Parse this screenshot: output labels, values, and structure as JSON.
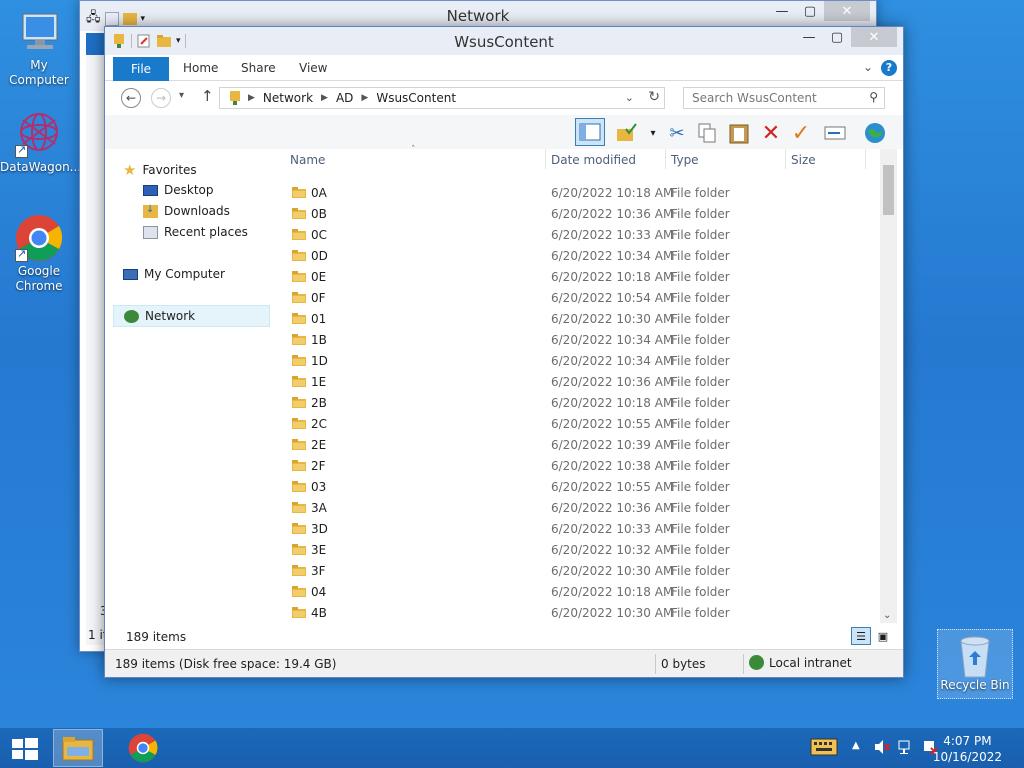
{
  "desktop": {
    "icons": [
      {
        "label": "My Computer"
      },
      {
        "label": "DataWagon..."
      },
      {
        "label": "Google Chrome"
      }
    ],
    "recycle_bin": "Recycle Bin"
  },
  "back_window": {
    "title": "Network",
    "items_stub": "1 it",
    "stub_three": "3"
  },
  "window": {
    "title": "WsusContent",
    "ribbon": {
      "file": "File",
      "tabs": [
        "Home",
        "Share",
        "View"
      ]
    },
    "address": {
      "segments": [
        "Network",
        "AD",
        "WsusContent"
      ],
      "search_placeholder": "Search WsusContent"
    },
    "nav": {
      "favorites": "Favorites",
      "desktop": "Desktop",
      "downloads": "Downloads",
      "recent": "Recent places",
      "my_computer": "My Computer",
      "network": "Network"
    },
    "columns": {
      "name": "Name",
      "date": "Date modified",
      "type": "Type",
      "size": "Size"
    },
    "rows": [
      {
        "name": "0A",
        "date": "6/20/2022 10:18 AM",
        "type": "File folder"
      },
      {
        "name": "0B",
        "date": "6/20/2022 10:36 AM",
        "type": "File folder"
      },
      {
        "name": "0C",
        "date": "6/20/2022 10:33 AM",
        "type": "File folder"
      },
      {
        "name": "0D",
        "date": "6/20/2022 10:34 AM",
        "type": "File folder"
      },
      {
        "name": "0E",
        "date": "6/20/2022 10:18 AM",
        "type": "File folder"
      },
      {
        "name": "0F",
        "date": "6/20/2022 10:54 AM",
        "type": "File folder"
      },
      {
        "name": "01",
        "date": "6/20/2022 10:30 AM",
        "type": "File folder"
      },
      {
        "name": "1B",
        "date": "6/20/2022 10:34 AM",
        "type": "File folder"
      },
      {
        "name": "1D",
        "date": "6/20/2022 10:34 AM",
        "type": "File folder"
      },
      {
        "name": "1E",
        "date": "6/20/2022 10:36 AM",
        "type": "File folder"
      },
      {
        "name": "2B",
        "date": "6/20/2022 10:18 AM",
        "type": "File folder"
      },
      {
        "name": "2C",
        "date": "6/20/2022 10:55 AM",
        "type": "File folder"
      },
      {
        "name": "2E",
        "date": "6/20/2022 10:39 AM",
        "type": "File folder"
      },
      {
        "name": "2F",
        "date": "6/20/2022 10:38 AM",
        "type": "File folder"
      },
      {
        "name": "03",
        "date": "6/20/2022 10:55 AM",
        "type": "File folder"
      },
      {
        "name": "3A",
        "date": "6/20/2022 10:36 AM",
        "type": "File folder"
      },
      {
        "name": "3D",
        "date": "6/20/2022 10:33 AM",
        "type": "File folder"
      },
      {
        "name": "3E",
        "date": "6/20/2022 10:32 AM",
        "type": "File folder"
      },
      {
        "name": "3F",
        "date": "6/20/2022 10:30 AM",
        "type": "File folder"
      },
      {
        "name": "04",
        "date": "6/20/2022 10:18 AM",
        "type": "File folder"
      },
      {
        "name": "4B",
        "date": "6/20/2022 10:30 AM",
        "type": "File folder"
      }
    ],
    "item_count": "189 items",
    "status": {
      "disk": "189 items (Disk free space: 19.4 GB)",
      "size": "0 bytes",
      "zone": "Local intranet"
    }
  },
  "taskbar": {
    "time": "4:07 PM",
    "date": "10/16/2022"
  },
  "colors": {
    "accent": "#1979ca",
    "desktop_bg": "#2579d0",
    "folder": "#e8b742"
  }
}
